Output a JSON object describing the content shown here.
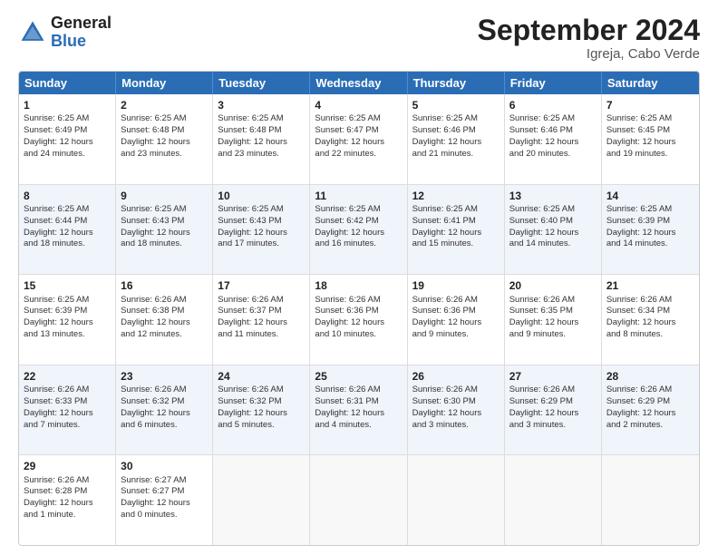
{
  "logo": {
    "line1": "General",
    "line2": "Blue"
  },
  "title": "September 2024",
  "subtitle": "Igreja, Cabo Verde",
  "header_days": [
    "Sunday",
    "Monday",
    "Tuesday",
    "Wednesday",
    "Thursday",
    "Friday",
    "Saturday"
  ],
  "rows": [
    [
      {
        "day": "1",
        "lines": [
          "Sunrise: 6:25 AM",
          "Sunset: 6:49 PM",
          "Daylight: 12 hours",
          "and 24 minutes."
        ]
      },
      {
        "day": "2",
        "lines": [
          "Sunrise: 6:25 AM",
          "Sunset: 6:48 PM",
          "Daylight: 12 hours",
          "and 23 minutes."
        ]
      },
      {
        "day": "3",
        "lines": [
          "Sunrise: 6:25 AM",
          "Sunset: 6:48 PM",
          "Daylight: 12 hours",
          "and 23 minutes."
        ]
      },
      {
        "day": "4",
        "lines": [
          "Sunrise: 6:25 AM",
          "Sunset: 6:47 PM",
          "Daylight: 12 hours",
          "and 22 minutes."
        ]
      },
      {
        "day": "5",
        "lines": [
          "Sunrise: 6:25 AM",
          "Sunset: 6:46 PM",
          "Daylight: 12 hours",
          "and 21 minutes."
        ]
      },
      {
        "day": "6",
        "lines": [
          "Sunrise: 6:25 AM",
          "Sunset: 6:46 PM",
          "Daylight: 12 hours",
          "and 20 minutes."
        ]
      },
      {
        "day": "7",
        "lines": [
          "Sunrise: 6:25 AM",
          "Sunset: 6:45 PM",
          "Daylight: 12 hours",
          "and 19 minutes."
        ]
      }
    ],
    [
      {
        "day": "8",
        "lines": [
          "Sunrise: 6:25 AM",
          "Sunset: 6:44 PM",
          "Daylight: 12 hours",
          "and 18 minutes."
        ]
      },
      {
        "day": "9",
        "lines": [
          "Sunrise: 6:25 AM",
          "Sunset: 6:43 PM",
          "Daylight: 12 hours",
          "and 18 minutes."
        ]
      },
      {
        "day": "10",
        "lines": [
          "Sunrise: 6:25 AM",
          "Sunset: 6:43 PM",
          "Daylight: 12 hours",
          "and 17 minutes."
        ]
      },
      {
        "day": "11",
        "lines": [
          "Sunrise: 6:25 AM",
          "Sunset: 6:42 PM",
          "Daylight: 12 hours",
          "and 16 minutes."
        ]
      },
      {
        "day": "12",
        "lines": [
          "Sunrise: 6:25 AM",
          "Sunset: 6:41 PM",
          "Daylight: 12 hours",
          "and 15 minutes."
        ]
      },
      {
        "day": "13",
        "lines": [
          "Sunrise: 6:25 AM",
          "Sunset: 6:40 PM",
          "Daylight: 12 hours",
          "and 14 minutes."
        ]
      },
      {
        "day": "14",
        "lines": [
          "Sunrise: 6:25 AM",
          "Sunset: 6:39 PM",
          "Daylight: 12 hours",
          "and 14 minutes."
        ]
      }
    ],
    [
      {
        "day": "15",
        "lines": [
          "Sunrise: 6:25 AM",
          "Sunset: 6:39 PM",
          "Daylight: 12 hours",
          "and 13 minutes."
        ]
      },
      {
        "day": "16",
        "lines": [
          "Sunrise: 6:26 AM",
          "Sunset: 6:38 PM",
          "Daylight: 12 hours",
          "and 12 minutes."
        ]
      },
      {
        "day": "17",
        "lines": [
          "Sunrise: 6:26 AM",
          "Sunset: 6:37 PM",
          "Daylight: 12 hours",
          "and 11 minutes."
        ]
      },
      {
        "day": "18",
        "lines": [
          "Sunrise: 6:26 AM",
          "Sunset: 6:36 PM",
          "Daylight: 12 hours",
          "and 10 minutes."
        ]
      },
      {
        "day": "19",
        "lines": [
          "Sunrise: 6:26 AM",
          "Sunset: 6:36 PM",
          "Daylight: 12 hours",
          "and 9 minutes."
        ]
      },
      {
        "day": "20",
        "lines": [
          "Sunrise: 6:26 AM",
          "Sunset: 6:35 PM",
          "Daylight: 12 hours",
          "and 9 minutes."
        ]
      },
      {
        "day": "21",
        "lines": [
          "Sunrise: 6:26 AM",
          "Sunset: 6:34 PM",
          "Daylight: 12 hours",
          "and 8 minutes."
        ]
      }
    ],
    [
      {
        "day": "22",
        "lines": [
          "Sunrise: 6:26 AM",
          "Sunset: 6:33 PM",
          "Daylight: 12 hours",
          "and 7 minutes."
        ]
      },
      {
        "day": "23",
        "lines": [
          "Sunrise: 6:26 AM",
          "Sunset: 6:32 PM",
          "Daylight: 12 hours",
          "and 6 minutes."
        ]
      },
      {
        "day": "24",
        "lines": [
          "Sunrise: 6:26 AM",
          "Sunset: 6:32 PM",
          "Daylight: 12 hours",
          "and 5 minutes."
        ]
      },
      {
        "day": "25",
        "lines": [
          "Sunrise: 6:26 AM",
          "Sunset: 6:31 PM",
          "Daylight: 12 hours",
          "and 4 minutes."
        ]
      },
      {
        "day": "26",
        "lines": [
          "Sunrise: 6:26 AM",
          "Sunset: 6:30 PM",
          "Daylight: 12 hours",
          "and 3 minutes."
        ]
      },
      {
        "day": "27",
        "lines": [
          "Sunrise: 6:26 AM",
          "Sunset: 6:29 PM",
          "Daylight: 12 hours",
          "and 3 minutes."
        ]
      },
      {
        "day": "28",
        "lines": [
          "Sunrise: 6:26 AM",
          "Sunset: 6:29 PM",
          "Daylight: 12 hours",
          "and 2 minutes."
        ]
      }
    ],
    [
      {
        "day": "29",
        "lines": [
          "Sunrise: 6:26 AM",
          "Sunset: 6:28 PM",
          "Daylight: 12 hours",
          "and 1 minute."
        ]
      },
      {
        "day": "30",
        "lines": [
          "Sunrise: 6:27 AM",
          "Sunset: 6:27 PM",
          "Daylight: 12 hours",
          "and 0 minutes."
        ]
      },
      {
        "day": "",
        "lines": []
      },
      {
        "day": "",
        "lines": []
      },
      {
        "day": "",
        "lines": []
      },
      {
        "day": "",
        "lines": []
      },
      {
        "day": "",
        "lines": []
      }
    ]
  ]
}
